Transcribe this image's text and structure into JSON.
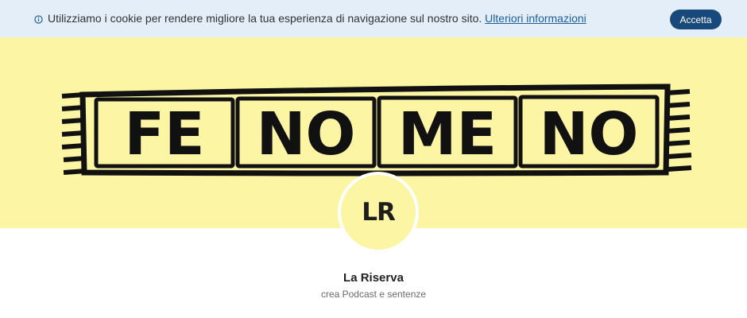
{
  "cookie_banner": {
    "icon": "info-icon",
    "message": "Utilizziamo i cookie per rendere migliore la tua esperienza di navigazione sul nostro sito.",
    "link_label": "Ulteriori informazioni",
    "accept_label": "Accetta"
  },
  "banner": {
    "logo_blocks": [
      "FE",
      "NO",
      "ME",
      "NO"
    ],
    "background_color": "#fbf5a4",
    "ink_color": "#111111"
  },
  "profile": {
    "avatar_initials": "LR",
    "name": "La Riserva",
    "tagline": "crea Podcast e sentenze"
  },
  "colors": {
    "cookie_bg": "#e4eef8",
    "accent": "#17497a",
    "link": "#1b5e9c"
  }
}
